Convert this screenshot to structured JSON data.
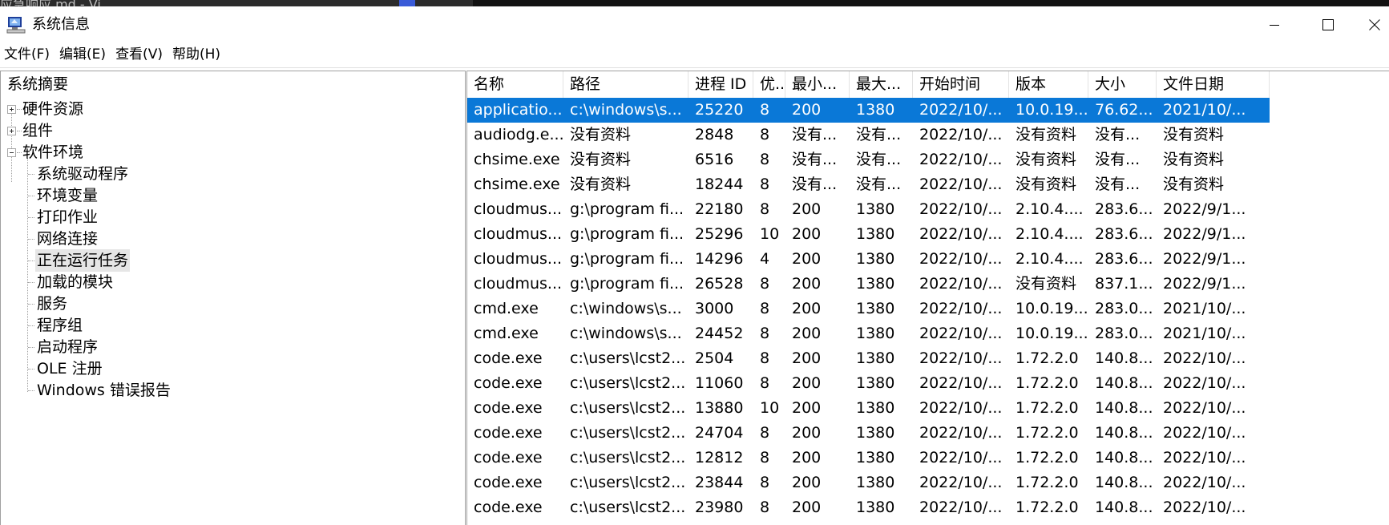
{
  "colors": {
    "selection": "#0a78d7",
    "selection_text": "#ffffff"
  },
  "window": {
    "title": "系统信息",
    "background_title_fragment": "应急响应.md - Vi...",
    "icon": "system-information-icon",
    "controls": [
      "minimize-icon",
      "maximize-icon",
      "close-icon"
    ]
  },
  "menu": [
    {
      "label": "文件(F)"
    },
    {
      "label": "编辑(E)"
    },
    {
      "label": "查看(V)"
    },
    {
      "label": "帮助(H)"
    }
  ],
  "tree": {
    "root": "系统摘要",
    "nodes": [
      {
        "label": "硬件资源",
        "expander": "plus"
      },
      {
        "label": "组件",
        "expander": "plus"
      },
      {
        "label": "软件环境",
        "expander": "minus"
      }
    ],
    "children": [
      "系统驱动程序",
      "环境变量",
      "打印作业",
      "网络连接",
      "正在运行任务",
      "加载的模块",
      "服务",
      "程序组",
      "启动程序",
      "OLE 注册",
      "Windows 错误报告"
    ],
    "selected": "正在运行任务"
  },
  "table": {
    "columns": [
      "名称",
      "路径",
      "进程 ID",
      "优...",
      "最小...",
      "最大...",
      "开始时间",
      "版本",
      "大小",
      "文件日期"
    ],
    "rows": [
      [
        "applicatio...",
        "c:\\windows\\s...",
        "25220",
        "8",
        "200",
        "1380",
        "2022/10/...",
        "10.0.19...",
        "76.62...",
        "2021/10/..."
      ],
      [
        "audiodg.e...",
        "没有资料",
        "2848",
        "8",
        "没有...",
        "没有...",
        "2022/10/...",
        "没有资料",
        "没有...",
        "没有资料"
      ],
      [
        "chsime.exe",
        "没有资料",
        "6516",
        "8",
        "没有...",
        "没有...",
        "2022/10/...",
        "没有资料",
        "没有...",
        "没有资料"
      ],
      [
        "chsime.exe",
        "没有资料",
        "18244",
        "8",
        "没有...",
        "没有...",
        "2022/10/...",
        "没有资料",
        "没有...",
        "没有资料"
      ],
      [
        "cloudmus...",
        "g:\\program fi...",
        "22180",
        "8",
        "200",
        "1380",
        "2022/10/...",
        "2.10.4....",
        "283.6...",
        "2022/9/1..."
      ],
      [
        "cloudmus...",
        "g:\\program fi...",
        "25296",
        "10",
        "200",
        "1380",
        "2022/10/...",
        "2.10.4....",
        "283.6...",
        "2022/9/1..."
      ],
      [
        "cloudmus...",
        "g:\\program fi...",
        "14296",
        "4",
        "200",
        "1380",
        "2022/10/...",
        "2.10.4....",
        "283.6...",
        "2022/9/1..."
      ],
      [
        "cloudmus...",
        "g:\\program fi...",
        "26528",
        "8",
        "200",
        "1380",
        "2022/10/...",
        "没有资料",
        "837.1...",
        "2022/9/1..."
      ],
      [
        "cmd.exe",
        "c:\\windows\\s...",
        "3000",
        "8",
        "200",
        "1380",
        "2022/10/...",
        "10.0.19...",
        "283.0...",
        "2021/10/..."
      ],
      [
        "cmd.exe",
        "c:\\windows\\s...",
        "24452",
        "8",
        "200",
        "1380",
        "2022/10/...",
        "10.0.19...",
        "283.0...",
        "2021/10/..."
      ],
      [
        "code.exe",
        "c:\\users\\lcst2...",
        "2504",
        "8",
        "200",
        "1380",
        "2022/10/...",
        "1.72.2.0",
        "140.8...",
        "2022/10/..."
      ],
      [
        "code.exe",
        "c:\\users\\lcst2...",
        "11060",
        "8",
        "200",
        "1380",
        "2022/10/...",
        "1.72.2.0",
        "140.8...",
        "2022/10/..."
      ],
      [
        "code.exe",
        "c:\\users\\lcst2...",
        "13880",
        "10",
        "200",
        "1380",
        "2022/10/...",
        "1.72.2.0",
        "140.8...",
        "2022/10/..."
      ],
      [
        "code.exe",
        "c:\\users\\lcst2...",
        "24704",
        "8",
        "200",
        "1380",
        "2022/10/...",
        "1.72.2.0",
        "140.8...",
        "2022/10/..."
      ],
      [
        "code.exe",
        "c:\\users\\lcst2...",
        "12812",
        "8",
        "200",
        "1380",
        "2022/10/...",
        "1.72.2.0",
        "140.8...",
        "2022/10/..."
      ],
      [
        "code.exe",
        "c:\\users\\lcst2...",
        "23844",
        "8",
        "200",
        "1380",
        "2022/10/...",
        "1.72.2.0",
        "140.8...",
        "2022/10/..."
      ],
      [
        "code.exe",
        "c:\\users\\lcst2...",
        "23980",
        "8",
        "200",
        "1380",
        "2022/10/...",
        "1.72.2.0",
        "140.8...",
        "2022/10/..."
      ]
    ],
    "selected_row": 0
  }
}
